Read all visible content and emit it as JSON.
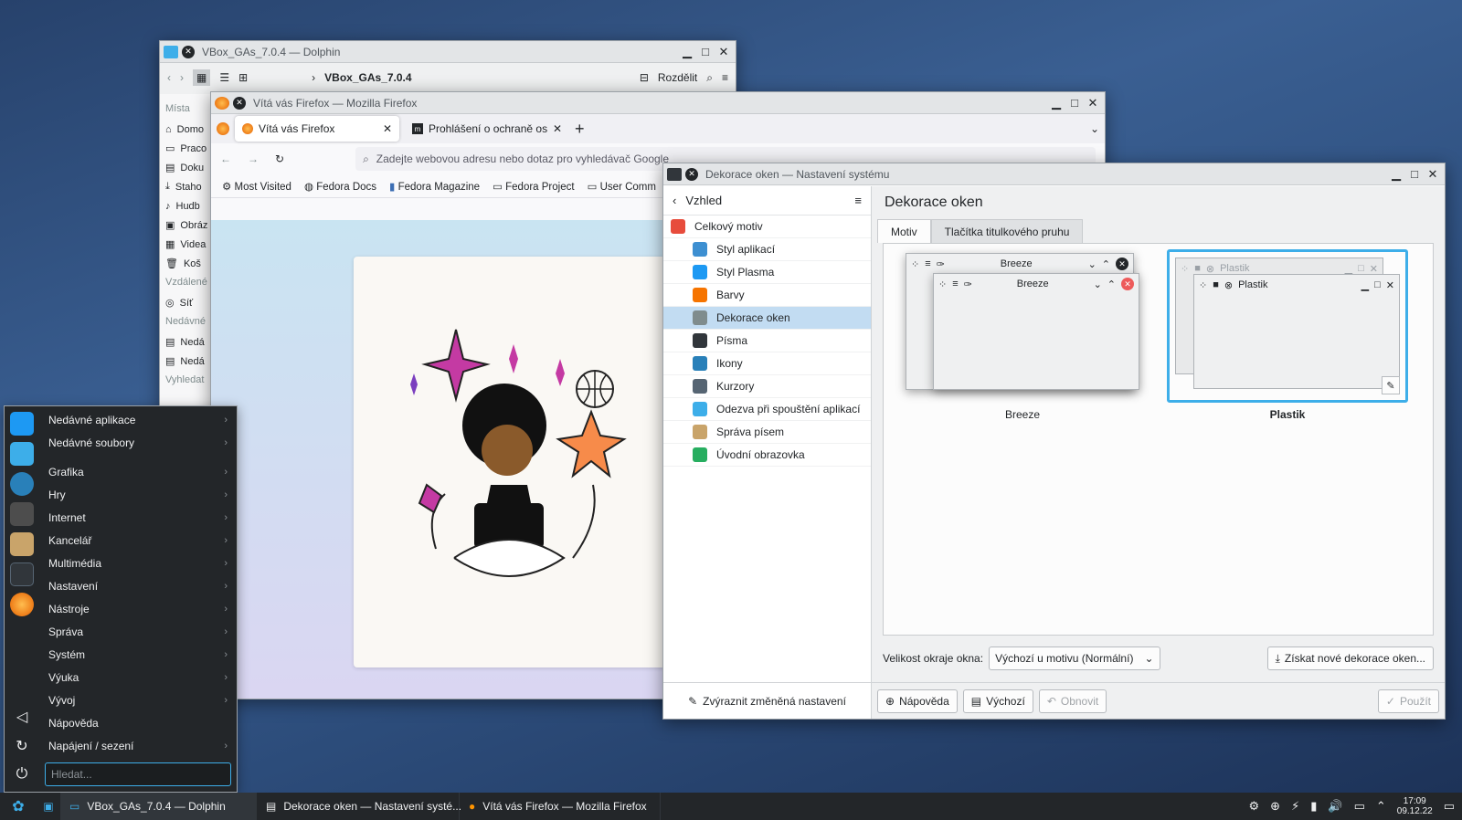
{
  "dolphin": {
    "title": "VBox_GAs_7.0.4 — Dolphin",
    "breadcrumb": "VBox_GAs_7.0.4",
    "split_label": "Rozdělit",
    "places_heading": "Místa",
    "places": [
      "Domo",
      "Praco",
      "Doku",
      "Staho",
      "Hudb",
      "Obráz",
      "Videa",
      "Koš"
    ],
    "remote_heading": "Vzdálené",
    "remote": [
      "Síť"
    ],
    "recent_heading": "Nedávné",
    "recent": [
      "Nedá",
      "Nedá"
    ],
    "search_heading": "Vyhledat"
  },
  "firefox": {
    "title": "Vítá vás Firefox — Mozilla Firefox",
    "tabs": [
      {
        "label": "Vítá vás Firefox"
      },
      {
        "label": "Prohlášení o ochraně osob"
      }
    ],
    "url_placeholder": "Zadejte webovou adresu nebo dotaz pro vyhledávač Google",
    "bookmarks": [
      "Most Visited",
      "Fedora Docs",
      "Fedora Magazine",
      "Fedora Project",
      "User Comm"
    ]
  },
  "settings": {
    "title": "Dekorace oken — Nastavení systému",
    "back_label": "Vzhled",
    "page_title": "Dekorace oken",
    "categories": [
      {
        "label": "Celkový motiv",
        "color": "#e74c3c"
      },
      {
        "label": "Styl aplikací",
        "color": "#3d8fd1"
      },
      {
        "label": "Styl Plasma",
        "color": "#1d99f3"
      },
      {
        "label": "Barvy",
        "color": "#f67400"
      },
      {
        "label": "Dekorace oken",
        "color": "#7f8c8d"
      },
      {
        "label": "Písma",
        "color": "#31363b"
      },
      {
        "label": "Ikony",
        "color": "#2980b9"
      },
      {
        "label": "Kurzory",
        "color": "#566573"
      },
      {
        "label": "Odezva při spouštění aplikací",
        "color": "#3daee9"
      },
      {
        "label": "Správa písem",
        "color": "#c9a46a"
      },
      {
        "label": "Úvodní obrazovka",
        "color": "#27ae60"
      }
    ],
    "highlight_label": "Zvýraznit změněná nastavení",
    "tabs": [
      "Motiv",
      "Tlačítka titulkového pruhu"
    ],
    "themes": [
      {
        "name": "Breeze",
        "mini_title": "Breeze"
      },
      {
        "name": "Plastik",
        "mini_title": "Plastik"
      }
    ],
    "border_size_label": "Velikost okraje okna:",
    "border_size_value": "Výchozí u motivu (Normální)",
    "get_new_label": "Získat nové dekorace oken...",
    "help_label": "Nápověda",
    "defaults_label": "Výchozí",
    "reset_label": "Obnovit",
    "apply_label": "Použít"
  },
  "menu": {
    "items": [
      {
        "label": "Nedávné aplikace",
        "sub": true
      },
      {
        "label": "Nedávné soubory",
        "sub": true
      },
      {
        "label": "Grafika",
        "sub": true
      },
      {
        "label": "Hry",
        "sub": true
      },
      {
        "label": "Internet",
        "sub": true
      },
      {
        "label": "Kancelář",
        "sub": true
      },
      {
        "label": "Multimédia",
        "sub": true
      },
      {
        "label": "Nastavení",
        "sub": true
      },
      {
        "label": "Nástroje",
        "sub": true
      },
      {
        "label": "Správa",
        "sub": true
      },
      {
        "label": "Systém",
        "sub": true
      },
      {
        "label": "Výuka",
        "sub": true
      },
      {
        "label": "Vývoj",
        "sub": true
      },
      {
        "label": "Nápověda",
        "sub": false
      },
      {
        "label": "Napájení / sezení",
        "sub": true
      }
    ],
    "search_placeholder": "Hledat..."
  },
  "taskbar": {
    "tasks": [
      "VBox_GAs_7.0.4 — Dolphin",
      "Dekorace oken — Nastavení systé...",
      "Vítá vás Firefox — Mozilla Firefox"
    ],
    "time": "17:09",
    "date": "09.12.22"
  }
}
